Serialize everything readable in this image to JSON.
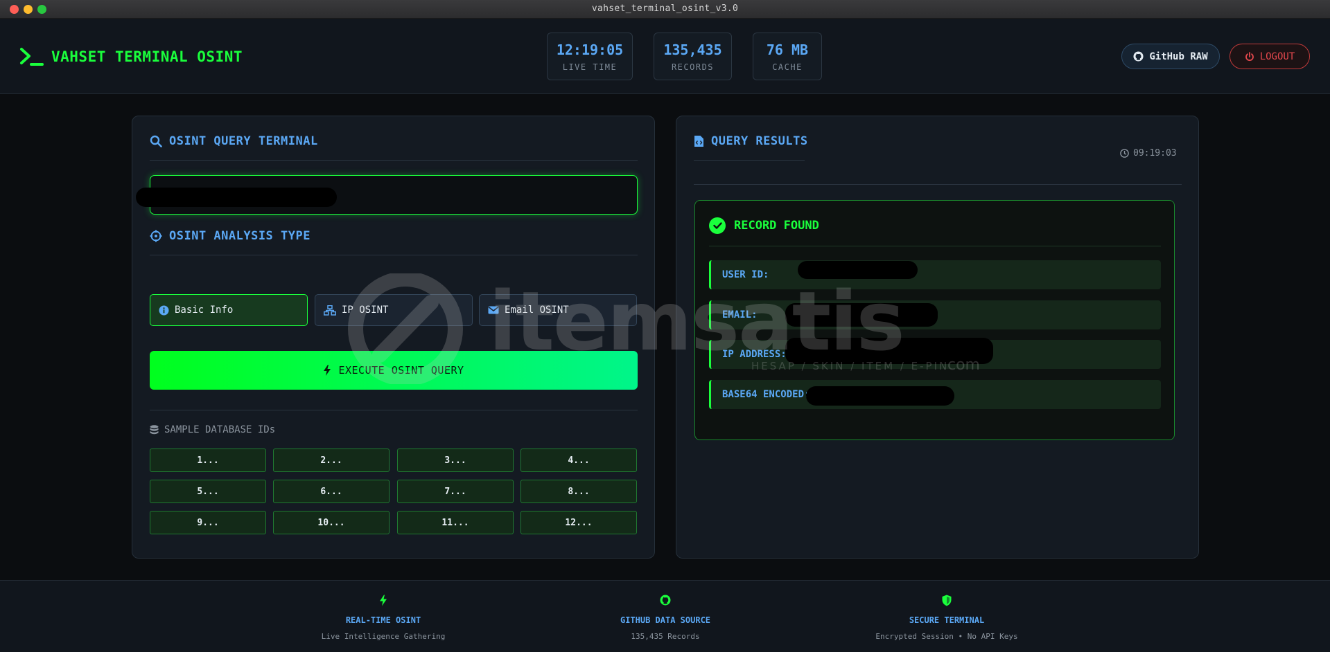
{
  "window": {
    "title": "vahset_terminal_osint_v3.0"
  },
  "header": {
    "logo_text": "VAHSET TERMINAL OSINT",
    "stats": [
      {
        "value": "12:19:05",
        "label": "LIVE TIME"
      },
      {
        "value": "135,435",
        "label": "RECORDS"
      },
      {
        "value": "76 MB",
        "label": "CACHE"
      }
    ],
    "github_label": "GitHub RAW",
    "logout_label": "LOGOUT"
  },
  "query_panel": {
    "title": "OSINT QUERY TERMINAL",
    "input_value": "",
    "analysis_title": "OSINT ANALYSIS TYPE",
    "types": [
      {
        "label": "Basic Info",
        "icon": "info-icon",
        "active": true
      },
      {
        "label": "IP OSINT",
        "icon": "network-icon",
        "active": false
      },
      {
        "label": "Email OSINT",
        "icon": "envelope-icon",
        "active": false
      }
    ],
    "execute_label": "EXECUTE OSINT QUERY",
    "sample_label": "SAMPLE DATABASE IDs",
    "sample_ids": [
      "1...",
      "2...",
      "3...",
      "4...",
      "5...",
      "6...",
      "7...",
      "8...",
      "9...",
      "10...",
      "11...",
      "12..."
    ]
  },
  "results_panel": {
    "title": "QUERY RESULTS",
    "timestamp": "09:19:03",
    "status": "RECORD FOUND",
    "fields": [
      {
        "label": "USER ID:"
      },
      {
        "label": "EMAIL:"
      },
      {
        "label": "IP ADDRESS:"
      },
      {
        "label": "BASE64 ENCODED:"
      }
    ]
  },
  "watermark": {
    "text": "itemsatis",
    "sub": "HESAP / SKIN / ITEM / E-PIN",
    "domain": ".com"
  },
  "footer": {
    "features": [
      {
        "title": "REAL-TIME OSINT",
        "desc": "Live Intelligence Gathering",
        "icon": "bolt-icon"
      },
      {
        "title": "GITHUB DATA SOURCE",
        "desc": "135,435 Records",
        "icon": "github-icon"
      },
      {
        "title": "SECURE TERMINAL",
        "desc": "Encrypted Session • No API Keys",
        "icon": "shield-icon"
      }
    ]
  },
  "colors": {
    "accent_green": "#1aff3c",
    "accent_blue": "#5ba8f5",
    "danger": "#e5484d"
  }
}
